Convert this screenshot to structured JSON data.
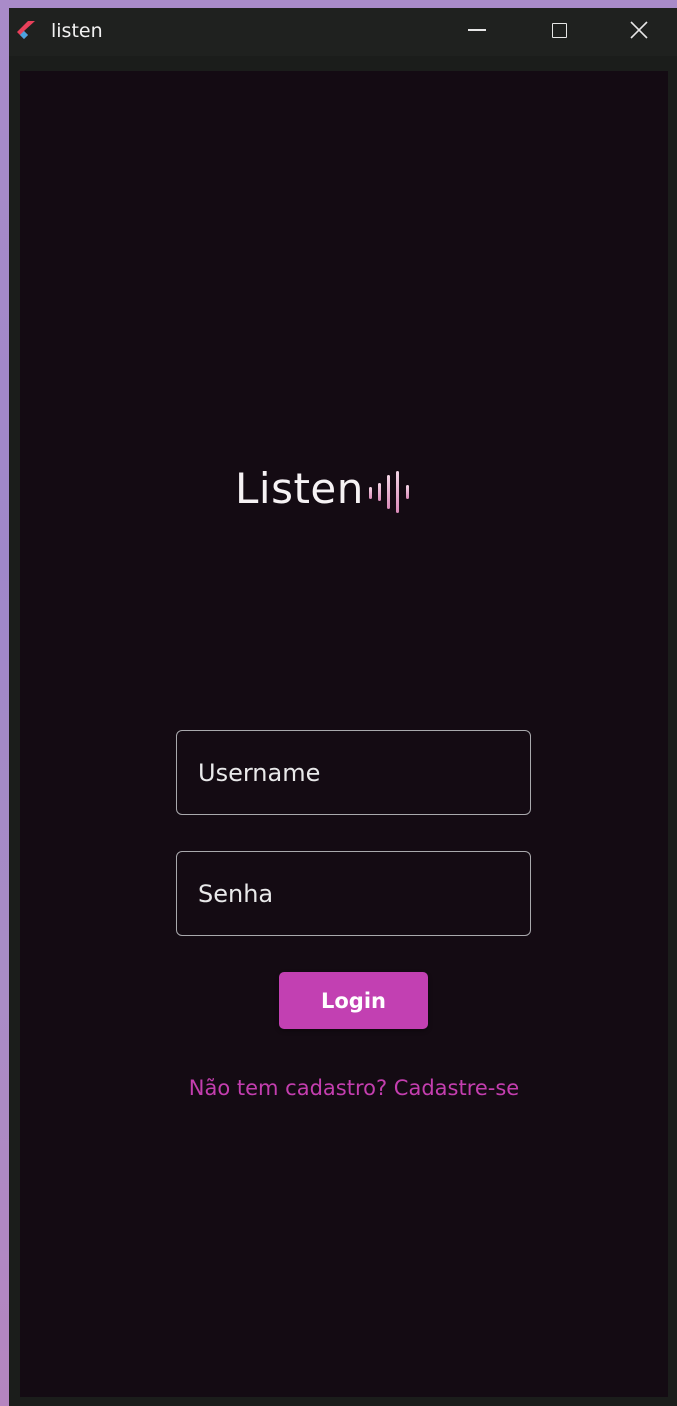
{
  "window": {
    "title": "listen",
    "icon": "flutter-logo-icon"
  },
  "app": {
    "logo_text": "Listen",
    "logo_icon": "audio-wave-icon",
    "accent_color": "#c240b2"
  },
  "form": {
    "username_placeholder": "Username",
    "username_value": "",
    "password_placeholder": "Senha",
    "password_value": "",
    "login_label": "Login",
    "signup_link": "Não tem cadastro? Cadastre-se"
  }
}
